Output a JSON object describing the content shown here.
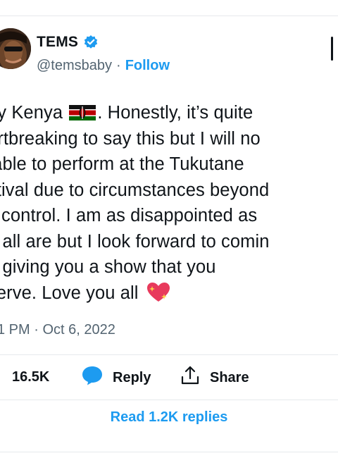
{
  "author": {
    "name": "TEMS",
    "handle": "@temsbaby",
    "separator": "·",
    "follow_label": "Follow",
    "verified": true
  },
  "tweet": {
    "lines": [
      "ey Kenya ",
      ". Honestly, it’s quite",
      "artbreaking to say this but I will no",
      " able to perform at the Tukutane",
      "stival due to circumstances beyond",
      "y control. I am as disappointed as",
      "u all are but I look forward to comin",
      "d giving you a show that you",
      "serve. Love you all "
    ],
    "emoji": [
      "kenya-flag",
      "sparkling-heart"
    ],
    "timestamp": "1 PM · Oct 6, 2022"
  },
  "actions": {
    "likes": "16.5K",
    "reply_label": "Reply",
    "share_label": "Share"
  },
  "replies": {
    "read_label": "Read 1.2K replies"
  },
  "colors": {
    "accent": "#1d9bf0",
    "secondary_text": "#536471",
    "divider": "#e6e9ec"
  }
}
